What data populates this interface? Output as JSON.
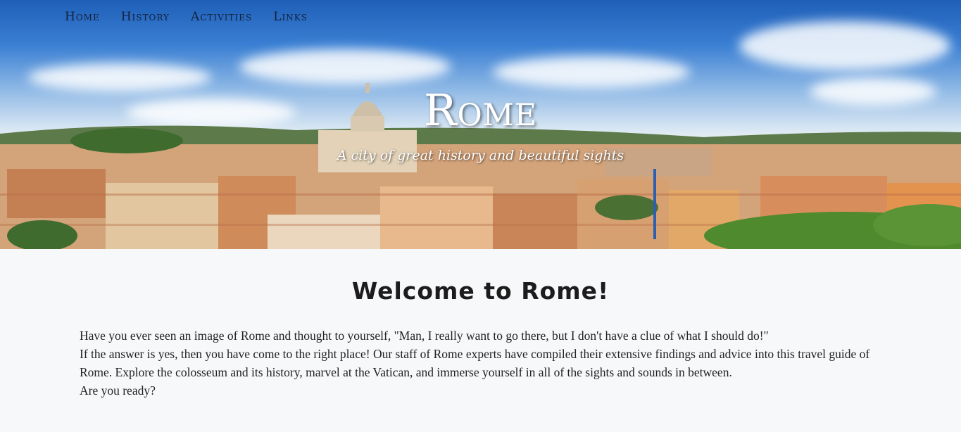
{
  "nav": {
    "items": [
      {
        "label": "Home"
      },
      {
        "label": "History"
      },
      {
        "label": "Activities"
      },
      {
        "label": "Links"
      }
    ]
  },
  "hero": {
    "title": "Rome",
    "subtitle": "A city of great history and beautiful sights",
    "image": "rome-skyline-panorama"
  },
  "main": {
    "heading": "Welcome to Rome!",
    "paragraphs": [
      "Have you ever seen an image of Rome and thought to yourself, \"Man, I really want to go there, but I don't have a clue of what I should do!\"",
      "If the answer is yes, then you have come to the right place! Our staff of Rome experts have compiled their extensive findings and advice into this travel guide of Rome. Explore the colosseum and its history, marvel at the Vatican, and immerse yourself in all of the sights and sounds in between.",
      "Are you ready?"
    ]
  },
  "colors": {
    "sky": "#2f72c8",
    "rooftops": "#c98a5a",
    "trees": "#3f6b2e",
    "page_background": "#f7f8fa",
    "text": "#222222"
  }
}
